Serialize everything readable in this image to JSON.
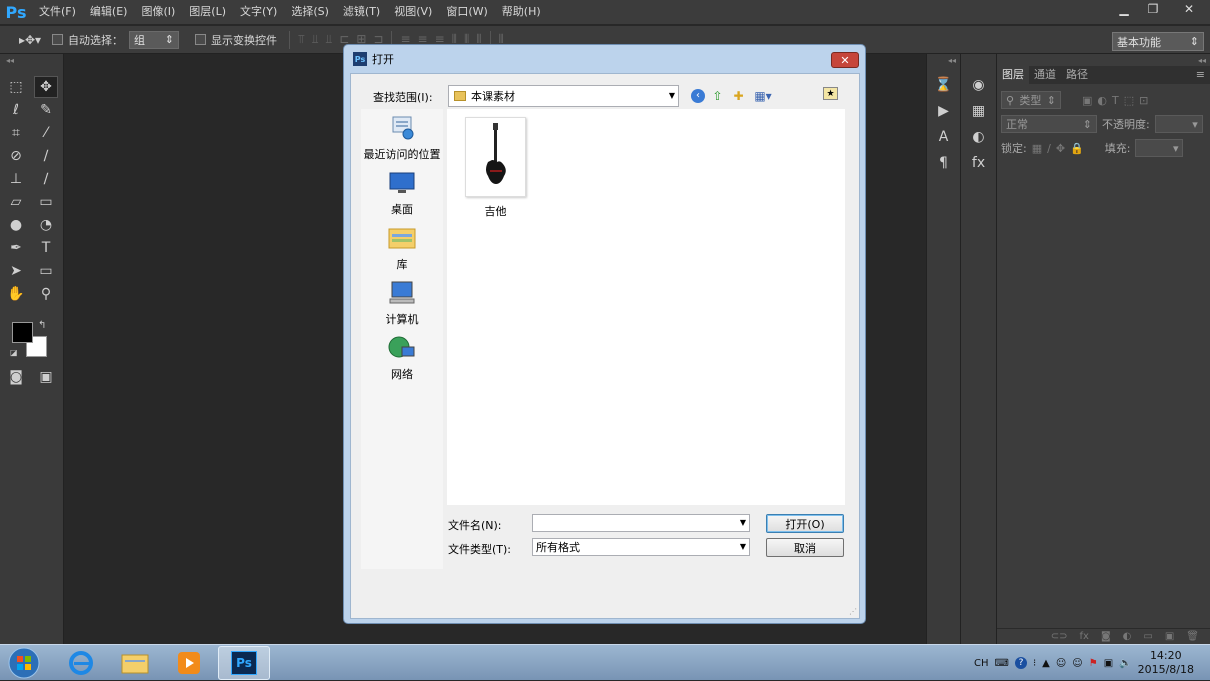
{
  "app": {
    "logo": "Ps"
  },
  "menu": [
    "文件(F)",
    "编辑(E)",
    "图像(I)",
    "图层(L)",
    "文字(Y)",
    "选择(S)",
    "滤镜(T)",
    "视图(V)",
    "窗口(W)",
    "帮助(H)"
  ],
  "window_controls": {
    "minimize": "▁",
    "restore": "❐",
    "close": "✕"
  },
  "options": {
    "auto_select_label": "自动选择：",
    "auto_select_value": "组",
    "show_transform_label": "显示变换控件"
  },
  "workspace": "基本功能",
  "panels": {
    "collapse_left": "◂◂",
    "collapse_right": "◂◂",
    "tabs": [
      "图层",
      "通道",
      "路径"
    ],
    "kind_label": "类型",
    "blend_mode": "正常",
    "opacity_label": "不透明度:",
    "lock_label": "锁定:",
    "fill_label": "填充:"
  },
  "dialog": {
    "title": "打开",
    "close": "✕",
    "look_in_label": "查找范围(I):",
    "look_in_value": "本课素材",
    "places": [
      "最近访问的位置",
      "桌面",
      "库",
      "计算机",
      "网络"
    ],
    "files": [
      {
        "name": "吉他",
        "type": "image"
      }
    ],
    "filename_label": "文件名(N):",
    "filename_value": "",
    "filetype_label": "文件类型(T):",
    "filetype_value": "所有格式",
    "open_button": "打开(O)",
    "cancel_button": "取消"
  },
  "taskbar": {
    "ime": "CH",
    "time": "14:20",
    "date": "2015/8/18"
  }
}
